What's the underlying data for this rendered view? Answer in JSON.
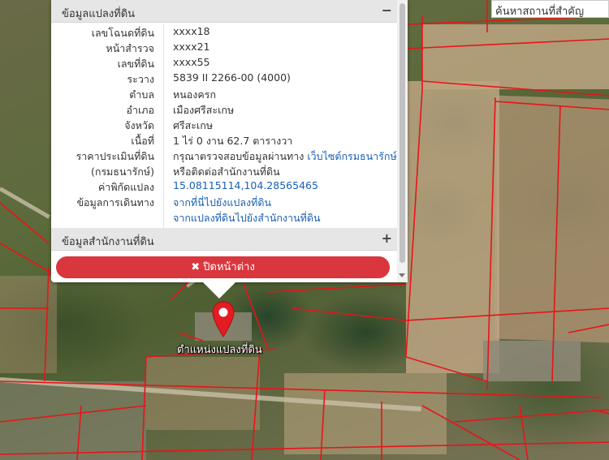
{
  "search": {
    "placeholder": "ค้นหาสถานที่สำคัญ"
  },
  "popup": {
    "section_parcel": {
      "title": "ข้อมูลแปลงที่ดิน",
      "toggle": "−"
    },
    "rows": [
      {
        "label": "เลขโฉนดที่ดิน",
        "value": "xxxx18"
      },
      {
        "label": "หน้าสำรวจ",
        "value": "xxxx21"
      },
      {
        "label": "เลขที่ดิน",
        "value": "xxxx55"
      },
      {
        "label": "ระวาง",
        "value": "5839 II 2266-00 (4000)"
      },
      {
        "label": "ตำบล",
        "value": "หนองครก"
      },
      {
        "label": "อำเภอ",
        "value": "เมืองศรีสะเกษ"
      },
      {
        "label": "จังหวัด",
        "value": "ศรีสะเกษ"
      },
      {
        "label": "เนื้อที่",
        "value": "1 ไร่ 0 งาน 62.7 ตารางวา"
      },
      {
        "label": "ราคาประเมินที่ดิน",
        "value": "กรุณาตรวจสอบข้อมูลผ่านทาง",
        "link": "เว็บไซต์กรมธนารักษ์"
      },
      {
        "label": "(กรมธนารักษ์)",
        "value": "หรือติดต่อสำนักงานที่ดิน"
      },
      {
        "label": "ค่าพิกัดแปลง",
        "link": "15.08115114,104.28565465"
      },
      {
        "label": "ข้อมูลการเดินทาง",
        "link": "จากที่นี่ไปยังแปลงที่ดิน"
      },
      {
        "label": "",
        "link": "จากแปลงที่ดินไปยังสำนักงานที่ดิน"
      }
    ],
    "section_office": {
      "title": "ข้อมูลสำนักงานที่ดิน",
      "toggle": "+"
    },
    "close_button": {
      "icon": "✖",
      "label": "ปิดหน้าต่าง"
    }
  },
  "marker": {
    "label": "ตำแหน่งแปลงที่ดิน",
    "color": "#e31b23"
  },
  "colors": {
    "parcel_boundary": "#e8141a",
    "close_button": "#d9363e",
    "link": "#1a5fb4"
  }
}
